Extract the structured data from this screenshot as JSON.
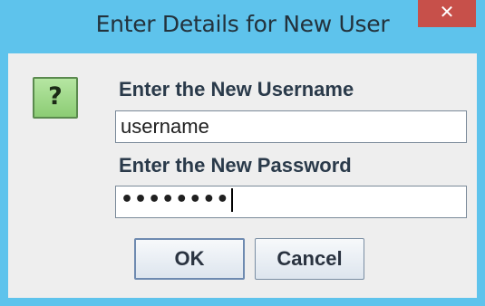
{
  "dialog": {
    "title": "Enter Details for New User",
    "close_glyph": "✕",
    "icon": {
      "name": "question-icon",
      "glyph": "?"
    },
    "username_label": "Enter the New Username",
    "username_value": "username",
    "password_label": "Enter the New Password",
    "password_value": "••••••••",
    "ok_label": "OK",
    "cancel_label": "Cancel"
  },
  "colors": {
    "titlebar": "#5ec3ec",
    "close_button": "#c7504a",
    "content_background": "#eeeeee",
    "icon_fill": "#8ccc74"
  }
}
